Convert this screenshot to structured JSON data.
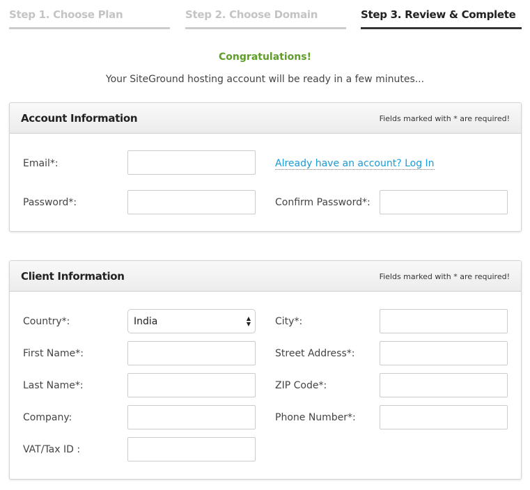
{
  "steps": [
    {
      "label": "Step 1. Choose Plan",
      "active": false
    },
    {
      "label": "Step 2. Choose Domain",
      "active": false
    },
    {
      "label": "Step 3. Review & Complete",
      "active": true
    }
  ],
  "congrats": "Congratulations!",
  "subtitle": "Your SiteGround hosting account will be ready in a few minutes...",
  "colors": {
    "success": "#5e9e28",
    "link": "#1a9ad6"
  },
  "account": {
    "title": "Account Information",
    "required_note": "Fields marked with * are required!",
    "email_label": "Email*:",
    "email_value": "",
    "login_link": "Already have an account? Log In",
    "password_label": "Password*:",
    "password_value": "",
    "confirm_label": "Confirm Password*:",
    "confirm_value": ""
  },
  "client": {
    "title": "Client Information",
    "required_note": "Fields marked with * are required!",
    "country_label": "Country*:",
    "country_value": "India",
    "first_name_label": "First Name*:",
    "last_name_label": "Last Name*:",
    "company_label": "Company:",
    "vat_label": "VAT/Tax ID :",
    "city_label": "City*:",
    "street_label": "Street Address*:",
    "zip_label": "ZIP Code*:",
    "phone_label": "Phone Number*:"
  }
}
